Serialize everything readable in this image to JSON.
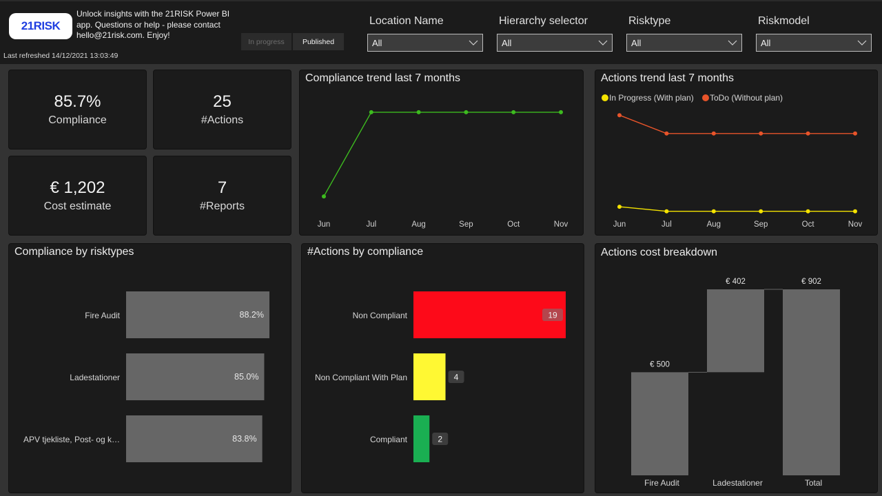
{
  "header": {
    "logo_text": "21RISK",
    "intro_text": "Unlock insights with the 21RISK Power BI app. Questions or help - please contact hello@21risk.com. Enjoy!",
    "last_refreshed": "Last refreshed 14/12/2021 13:03:49",
    "toggle": {
      "in_progress": "In progress",
      "published": "Published",
      "selected": "Published"
    }
  },
  "slicers": [
    {
      "label": "Location Name",
      "value": "All"
    },
    {
      "label": "Hierarchy selector",
      "value": "All"
    },
    {
      "label": "Risktype",
      "value": "All"
    },
    {
      "label": "Riskmodel",
      "value": "All"
    }
  ],
  "kpis": {
    "compliance": {
      "value": "85.7%",
      "caption": "Compliance"
    },
    "actions": {
      "value": "25",
      "caption": "#Actions"
    },
    "cost": {
      "value": "€ 1,202",
      "caption": "Cost estimate"
    },
    "reports": {
      "value": "7",
      "caption": "#Reports"
    }
  },
  "colors": {
    "compliance_line": "#3dbb1f",
    "in_progress": "#f5e300",
    "todo": "#e8542a",
    "bar_gray": "#666666",
    "non_compliant": "#fd0a19",
    "non_compliant_plan": "#fff833",
    "compliant": "#1aaf52"
  },
  "chart_data": [
    {
      "id": "compliance_trend",
      "type": "line",
      "title": "Compliance trend last 7 months",
      "x": [
        "Jun",
        "Jul",
        "Aug",
        "Sep",
        "Oct",
        "Nov"
      ],
      "series": [
        {
          "name": "Compliance",
          "values": [
            79,
            86,
            86,
            86,
            86,
            86
          ]
        }
      ],
      "ylim": [
        77,
        88
      ],
      "grid": false
    },
    {
      "id": "actions_trend",
      "type": "line",
      "title": "Actions trend last 7 months",
      "x": [
        "Jun",
        "Jul",
        "Aug",
        "Sep",
        "Oct",
        "Nov"
      ],
      "series": [
        {
          "name": "In Progress (With plan)",
          "values": [
            5,
            4,
            4,
            4,
            4,
            4
          ]
        },
        {
          "name": "ToDo (Without plan)",
          "values": [
            25,
            21,
            21,
            21,
            21,
            21
          ]
        }
      ],
      "ylim": [
        2,
        30
      ],
      "legend": "top-left",
      "grid": false
    },
    {
      "id": "compliance_by_risktypes",
      "type": "bar",
      "orientation": "horizontal",
      "title": "Compliance by risktypes",
      "categories": [
        "Fire Audit",
        "Ladestationer",
        "APV tjekliste, Post- og k…"
      ],
      "values": [
        88.2,
        85.0,
        83.8
      ],
      "labels": [
        "88.2%",
        "85.0%",
        "83.8%"
      ]
    },
    {
      "id": "actions_by_compliance",
      "type": "bar",
      "orientation": "horizontal",
      "title": "#Actions by compliance",
      "categories": [
        "Non Compliant",
        "Non Compliant With Plan",
        "Compliant"
      ],
      "values": [
        19,
        4,
        2
      ],
      "labels": [
        "19",
        "4",
        "2"
      ]
    },
    {
      "id": "actions_cost_breakdown",
      "type": "bar",
      "subtype": "waterfall",
      "title": "Actions cost breakdown",
      "categories": [
        "Fire Audit",
        "Ladestationer",
        "Total"
      ],
      "values": [
        500,
        402,
        902
      ],
      "labels": [
        "€ 500",
        "€ 402",
        "€ 902"
      ]
    }
  ]
}
